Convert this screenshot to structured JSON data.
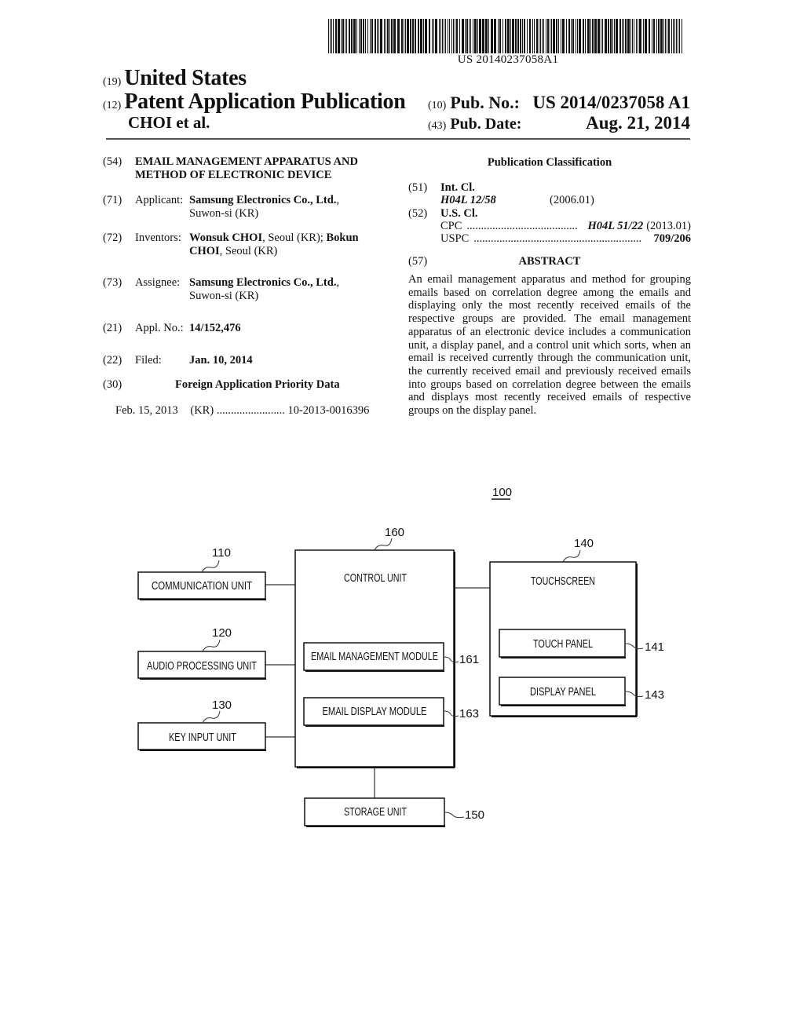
{
  "header": {
    "barcode_number": "US 20140237058A1",
    "country_code": "(19)",
    "country": "United States",
    "type_code": "(12)",
    "type": "Patent Application Publication",
    "authors": "CHOI et al.",
    "pub_no_code": "(10)",
    "pub_no_label": "Pub. No.:",
    "pub_no": "US 2014/0237058 A1",
    "pub_date_code": "(43)",
    "pub_date_label": "Pub. Date:",
    "pub_date": "Aug. 21, 2014"
  },
  "left": {
    "title": {
      "code": "(54)",
      "line1": "EMAIL MANAGEMENT APPARATUS AND",
      "line2": "METHOD OF ELECTRONIC DEVICE"
    },
    "applicant": {
      "code": "(71)",
      "label": "Applicant:",
      "name": "Samsung Electronics Co., Ltd.",
      "suffix": ",",
      "location": "Suwon-si (KR)"
    },
    "inventors": {
      "code": "(72)",
      "label": "Inventors:",
      "name1": "Wonsuk CHOI",
      "loc1": ", Seoul (KR); ",
      "name2a": "Bokun",
      "name2b": "CHOI",
      "loc2": ", Seoul (KR)"
    },
    "assignee": {
      "code": "(73)",
      "label": "Assignee:",
      "name": "Samsung Electronics Co., Ltd.",
      "suffix": ",",
      "location": "Suwon-si (KR)"
    },
    "appl_no": {
      "code": "(21)",
      "label": "Appl. No.:",
      "value": "14/152,476"
    },
    "filed": {
      "code": "(22)",
      "label": "Filed:",
      "value": "Jan. 10, 2014"
    },
    "foreign": {
      "code": "(30)",
      "heading": "Foreign Application Priority Data",
      "date": "Feb. 15, 2013",
      "country": "(KR)",
      "dots": "........................",
      "number": "10-2013-0016396"
    }
  },
  "right": {
    "classification_heading": "Publication Classification",
    "int_cl": {
      "code": "(51)",
      "label": "Int. Cl.",
      "class": "H04L 12/58",
      "version": "(2006.01)"
    },
    "us_cl": {
      "code": "(52)",
      "label": "U.S. Cl.",
      "cpc_label": "CPC",
      "cpc_dots": ".......................................",
      "cpc_class": "H04L 51/22",
      "cpc_version": "(2013.01)",
      "uspc_label": "USPC",
      "uspc_dots": "...........................................................",
      "uspc_value": "709/206"
    },
    "abstract_code": "(57)",
    "abstract_heading": "ABSTRACT",
    "abstract_text": "An email management apparatus and method for grouping emails based on correlation degree among the emails and displaying only the most recently received emails of the respective groups are provided. The email management apparatus of an electronic device includes a communication unit, a display panel, and a control unit which sorts, when an email is received currently through the communication unit, the currently received email and previously received emails into groups based on correlation degree between the emails and displays most recently received emails of respective groups on the display panel."
  },
  "diagram": {
    "figure_ref": "100",
    "blocks": {
      "communication_unit": {
        "label": "COMMUNICATION UNIT",
        "ref": "110"
      },
      "audio_processing_unit": {
        "label": "AUDIO PROCESSING UNIT",
        "ref": "120"
      },
      "key_input_unit": {
        "label": "KEY INPUT UNIT",
        "ref": "130"
      },
      "control_unit": {
        "label": "CONTROL UNIT",
        "ref": "160"
      },
      "email_management_module": {
        "label": "EMAIL MANAGEMENT MODULE",
        "ref": "161"
      },
      "email_display_module": {
        "label": "EMAIL DISPLAY MODULE",
        "ref": "163"
      },
      "touchscreen": {
        "label": "TOUCHSCREEN",
        "ref": "140"
      },
      "touch_panel": {
        "label": "TOUCH PANEL",
        "ref": "141"
      },
      "display_panel": {
        "label": "DISPLAY PANEL",
        "ref": "143"
      },
      "storage_unit": {
        "label": "STORAGE UNIT",
        "ref": "150"
      }
    }
  }
}
